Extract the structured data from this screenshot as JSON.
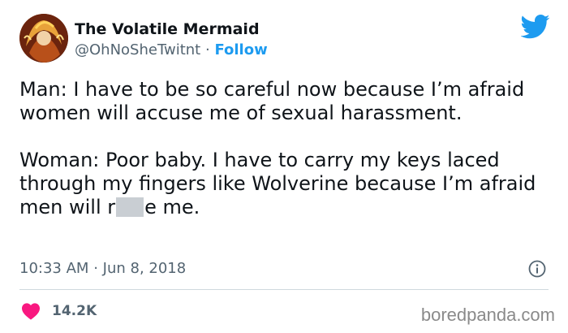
{
  "user": {
    "name": "The Volatile Mermaid",
    "handle": "@OhNoSheTwitnt",
    "separator": "·",
    "follow_label": "Follow"
  },
  "tweet": {
    "paragraph1": "Man: I have to be so careful now because I’m afraid women will accuse me of sexual harassment.",
    "paragraph2_before": "Woman: Poor baby. I have to carry my keys laced through my fingers like Wolverine because I’m afraid men will r",
    "paragraph2_after": "e me.",
    "time": "10:33 AM",
    "meta_separator": "·",
    "date": "Jun 8, 2018",
    "likes": "14.2K"
  },
  "icons": {
    "platform": "twitter-bird-icon",
    "info": "info-icon",
    "like": "heart-icon"
  },
  "colors": {
    "accent": "#1d9bf0",
    "like": "#f91880",
    "secondary_text": "#536471",
    "censor_block": "#c9ced3"
  },
  "watermark": "boredpanda.com"
}
